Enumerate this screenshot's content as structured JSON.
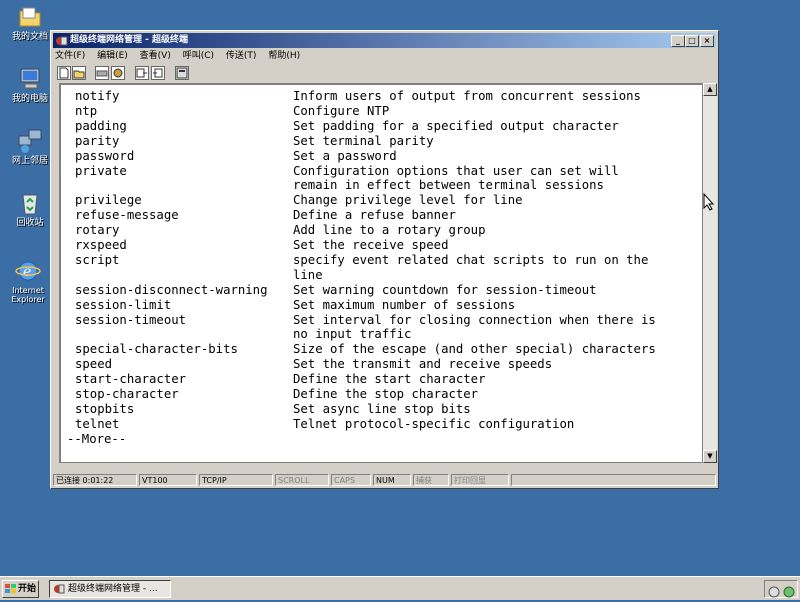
{
  "desktop": {
    "icons": [
      {
        "label": "我的文档",
        "icon": "my-documents-icon"
      },
      {
        "label": "我的电脑",
        "icon": "my-computer-icon"
      },
      {
        "label": "网上邻居",
        "icon": "network-places-icon"
      },
      {
        "label": "回收站",
        "icon": "recycle-bin-icon"
      },
      {
        "label": "Internet Explorer",
        "icon": "internet-explorer-icon"
      }
    ]
  },
  "window": {
    "title": "超级终端网络管理 - 超级终端",
    "controls": {
      "minimize": "_",
      "maximize": "□",
      "close": "×"
    },
    "menu": [
      "文件(F)",
      "编辑(E)",
      "查看(V)",
      "呼叫(C)",
      "传送(T)",
      "帮助(H)"
    ],
    "toolbar_icons": [
      "new-icon",
      "open-icon",
      "disconnect-icon",
      "call-icon",
      "send-icon",
      "receive-icon",
      "properties-icon"
    ]
  },
  "terminal": {
    "rows": [
      {
        "cmd": "notify",
        "desc": "Inform users of output from concurrent sessions"
      },
      {
        "cmd": "ntp",
        "desc": "Configure NTP"
      },
      {
        "cmd": "padding",
        "desc": "Set padding for a specified output character"
      },
      {
        "cmd": "parity",
        "desc": "Set terminal parity"
      },
      {
        "cmd": "password",
        "desc": "Set a password"
      },
      {
        "cmd": "private",
        "desc": "Configuration options that user can set will"
      },
      {
        "cmd": "",
        "desc": "remain in effect between terminal sessions"
      },
      {
        "cmd": "privilege",
        "desc": "Change privilege level for line"
      },
      {
        "cmd": "refuse-message",
        "desc": "Define a refuse banner"
      },
      {
        "cmd": "rotary",
        "desc": "Add line to a rotary group"
      },
      {
        "cmd": "rxspeed",
        "desc": "Set the receive speed"
      },
      {
        "cmd": "script",
        "desc": "specify event related chat scripts to run on the"
      },
      {
        "cmd": "",
        "desc": "line"
      },
      {
        "cmd": "session-disconnect-warning",
        "desc": "Set warning countdown for session-timeout"
      },
      {
        "cmd": "session-limit",
        "desc": "Set maximum number of sessions"
      },
      {
        "cmd": "session-timeout",
        "desc": "Set interval for closing connection when there is"
      },
      {
        "cmd": "",
        "desc": "no input traffic"
      },
      {
        "cmd": "special-character-bits",
        "desc": "Size of the escape (and other special) characters"
      },
      {
        "cmd": "speed",
        "desc": "Set the transmit and receive speeds"
      },
      {
        "cmd": "start-character",
        "desc": "Define the start character"
      },
      {
        "cmd": "stop-character",
        "desc": "Define the stop character"
      },
      {
        "cmd": "stopbits",
        "desc": "Set async line stop bits"
      },
      {
        "cmd": "telnet",
        "desc": "Telnet protocol-specific configuration"
      }
    ],
    "more": "--More--"
  },
  "statusbar": {
    "connected": "已连接 0:01:22",
    "emulation": "VT100",
    "protocol": "TCP/IP",
    "scroll": "SCROLL",
    "caps": "CAPS",
    "num": "NUM",
    "capture": "捕获",
    "print_echo": "打印回显"
  },
  "taskbar": {
    "start": "开始",
    "task": "超级终端网络管理 - ..."
  }
}
